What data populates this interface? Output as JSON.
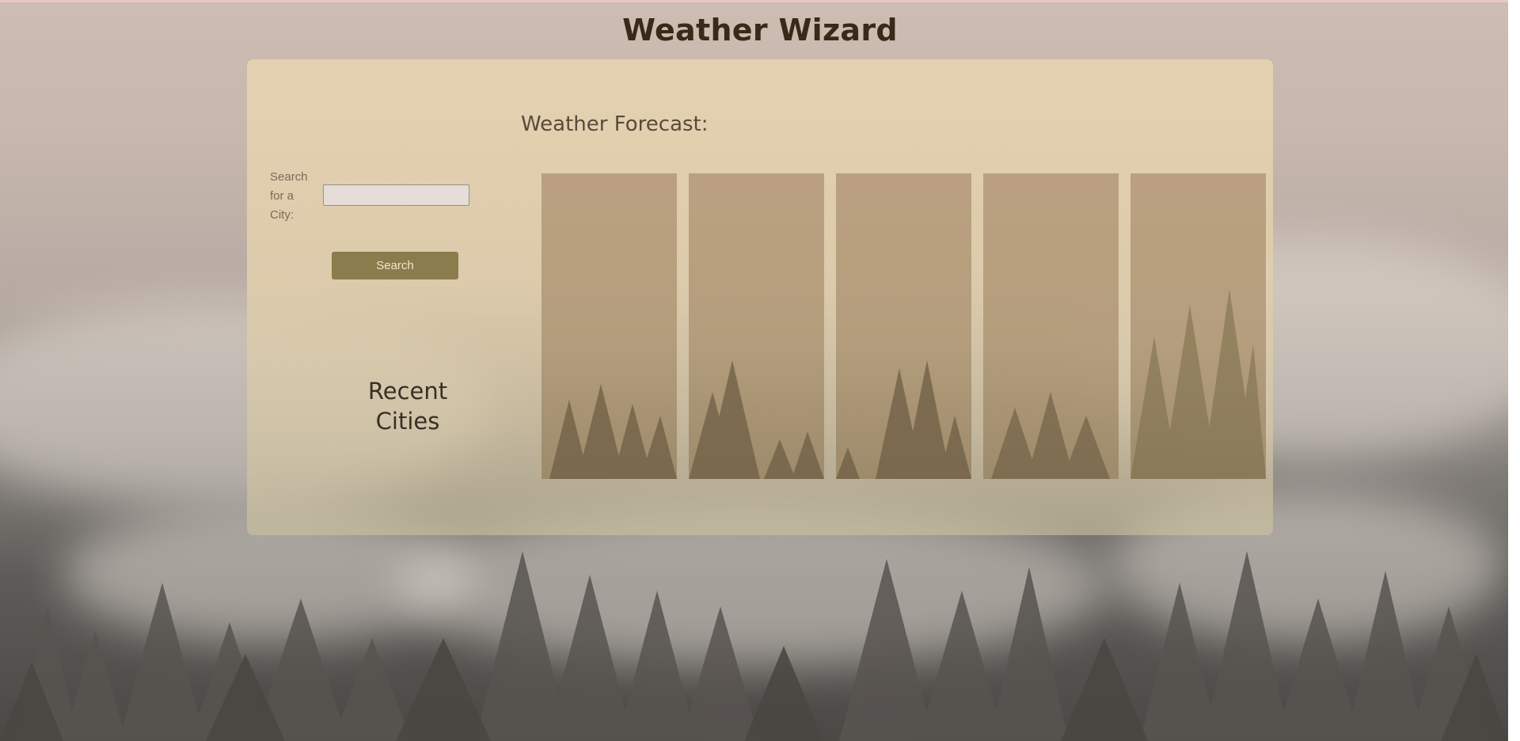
{
  "app": {
    "title": "Weather Wizard"
  },
  "search": {
    "label": "Search for a City:",
    "value": "",
    "placeholder": "",
    "button_label": "Search"
  },
  "recent": {
    "title": "Recent Cities",
    "items": []
  },
  "forecast": {
    "title": "Weather Forecast:",
    "cards": [
      {
        "day": ""
      },
      {
        "day": ""
      },
      {
        "day": ""
      },
      {
        "day": ""
      },
      {
        "day": ""
      }
    ]
  },
  "colors": {
    "title_text": "#3a2818",
    "panel": "#e2d0ae",
    "button": "#8a7c4c",
    "button_text": "#efe6cf",
    "card": "#b0946f"
  }
}
